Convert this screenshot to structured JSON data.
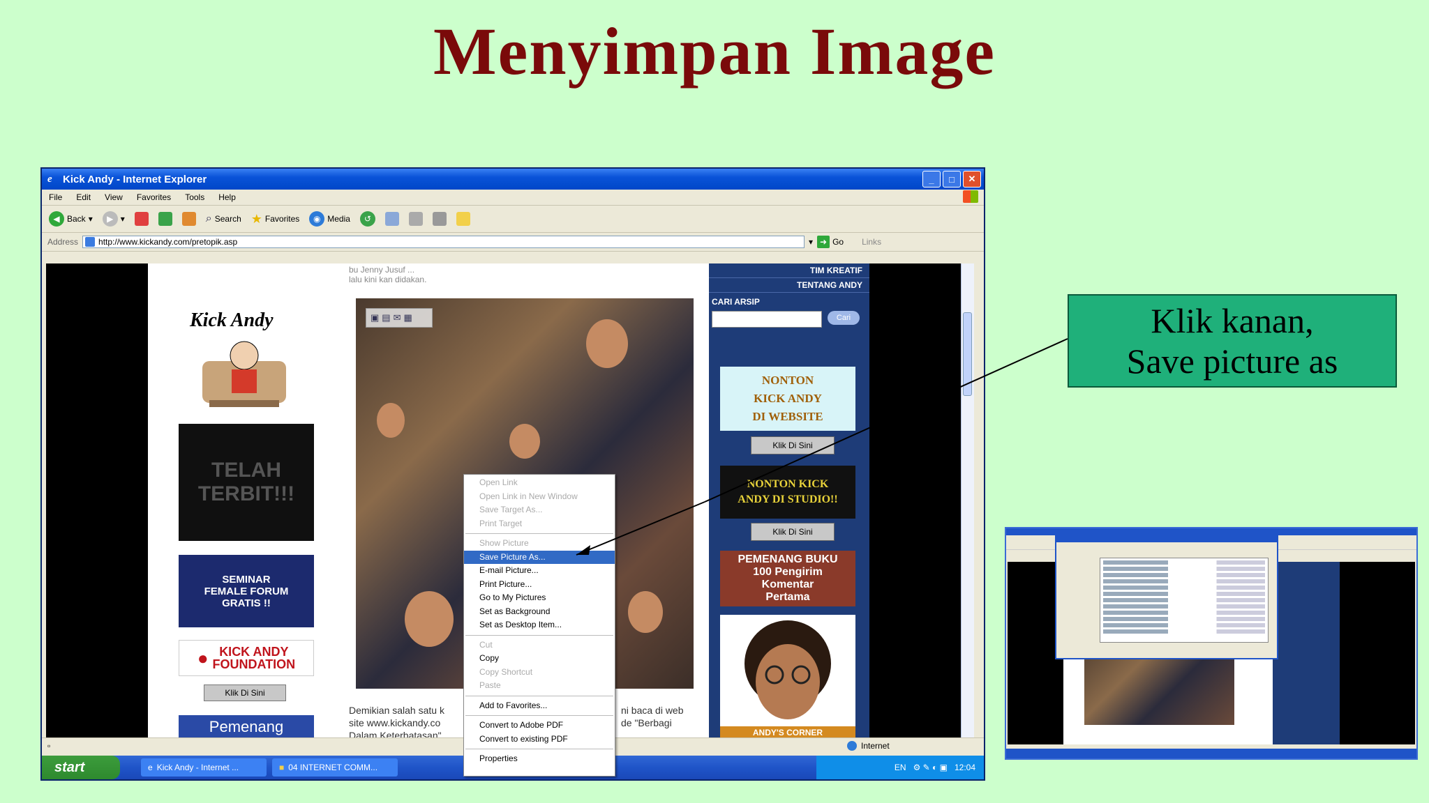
{
  "slide": {
    "title": "Menyimpan Image",
    "callout": [
      "Klik kanan,",
      "Save picture as"
    ]
  },
  "browser": {
    "window_title": "Kick Andy - Internet Explorer",
    "menu": [
      "File",
      "Edit",
      "View",
      "Favorites",
      "Tools",
      "Help"
    ],
    "toolbar": {
      "back": "Back",
      "search": "Search",
      "favorites": "Favorites",
      "media": "Media"
    },
    "address_label": "Address",
    "address_url": "http://www.kickandy.com/pretopik.asp",
    "go": "Go",
    "links": "Links",
    "status_zone": "Internet"
  },
  "page": {
    "logo": "Kick Andy",
    "banner_black": "TELAH TERBIT!!!",
    "seminar": [
      "SEMINAR",
      "FEMALE FORUM",
      "GRATIS !!"
    ],
    "foundation": [
      "KICK ANDY",
      "FOUNDATION"
    ],
    "klik_di_sini": "Klik Di Sini",
    "pemenang": "Pemenang",
    "mid_top_text": [
      "bu Jenny Jusuf ... ",
      "lalu kini kan didakan."
    ],
    "mid_bottom_text": [
      "Demikian salah satu k",
      "site www.kickandy.co",
      "Dalam Keterbatasan\""
    ],
    "mid_bottom_right": [
      "ni baca di web",
      "de \"Berbagi"
    ],
    "right_nav": [
      "TIM KREATIF",
      "TENTANG ANDY"
    ],
    "cari_arsip": "CARI ARSIP",
    "cari_btn": "Cari",
    "nonton_web": [
      "NONTON",
      "KICK ANDY",
      "DI WEBSITE"
    ],
    "nonton_studio": [
      "NONTON KICK",
      "ANDY DI STUDIO!!"
    ],
    "pemenang_buku": [
      "PEMENANG BUKU",
      "100 Pengirim",
      "Komentar",
      "Pertama"
    ],
    "andy_caption": "ANDY'S CORNER"
  },
  "context_menu": {
    "groups": [
      [
        {
          "label": "Open Link",
          "disabled": true
        },
        {
          "label": "Open Link in New Window",
          "disabled": true
        },
        {
          "label": "Save Target As...",
          "disabled": true
        },
        {
          "label": "Print Target",
          "disabled": true
        }
      ],
      [
        {
          "label": "Show Picture",
          "disabled": true
        },
        {
          "label": "Save Picture As...",
          "selected": true
        },
        {
          "label": "E-mail Picture..."
        },
        {
          "label": "Print Picture..."
        },
        {
          "label": "Go to My Pictures"
        },
        {
          "label": "Set as Background"
        },
        {
          "label": "Set as Desktop Item..."
        }
      ],
      [
        {
          "label": "Cut",
          "disabled": true
        },
        {
          "label": "Copy"
        },
        {
          "label": "Copy Shortcut",
          "disabled": true
        },
        {
          "label": "Paste",
          "disabled": true
        }
      ],
      [
        {
          "label": "Add to Favorites..."
        }
      ],
      [
        {
          "label": "Convert to Adobe PDF"
        },
        {
          "label": "Convert to existing PDF"
        }
      ],
      [
        {
          "label": "Properties"
        }
      ]
    ]
  },
  "taskbar": {
    "start": "start",
    "tasks": [
      "Kick Andy - Internet ...",
      "04 INTERNET COMM..."
    ],
    "tray_lang": "EN",
    "clock": "12:04"
  },
  "colors": {
    "slide_bg": "#ccffcc",
    "title": "#7a0a0a",
    "callout_bg": "#1fb07a",
    "menu_selected": "#316ac5"
  }
}
